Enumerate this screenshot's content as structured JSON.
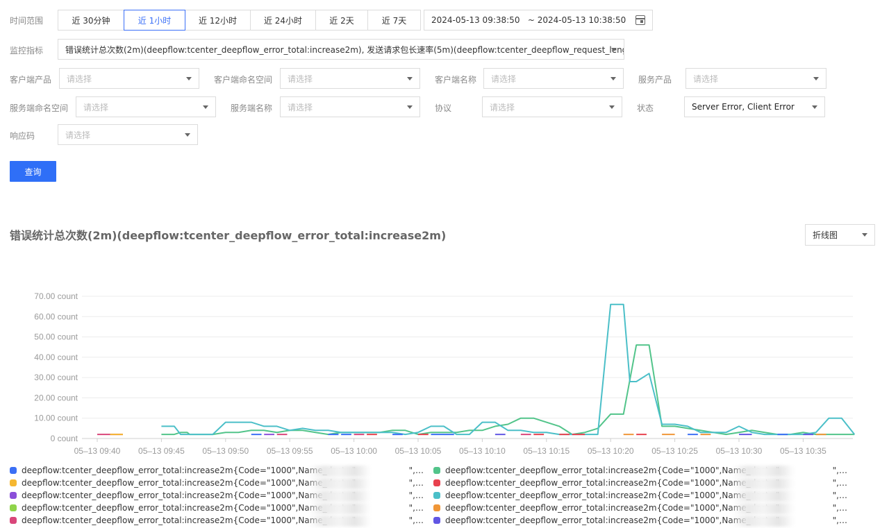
{
  "time_range": {
    "label": "时间范围",
    "options": [
      "近 30分钟",
      "近 1小时",
      "近 12小时",
      "近 24小时",
      "近 2天",
      "近 7天"
    ],
    "active_index": 1,
    "range_text": "2024-05-13 09:38:50   ~ 2024-05-13 10:38:50"
  },
  "metric": {
    "label": "监控指标",
    "value": "错误统计总次数(2m)(deepflow:tcenter_deepflow_error_total:increase2m), 发送请求包长速率(5m)(deepflow:tcenter_deepflow_request_length:ra..."
  },
  "filters": {
    "client_product": {
      "label": "客户端产品",
      "placeholder": "请选择"
    },
    "client_namespace": {
      "label": "客户端命名空间",
      "placeholder": "请选择"
    },
    "client_name": {
      "label": "客户端名称",
      "placeholder": "请选择"
    },
    "service_product": {
      "label": "服务产品",
      "placeholder": "请选择"
    },
    "server_namespace": {
      "label": "服务端命名空间",
      "placeholder": "请选择"
    },
    "server_name": {
      "label": "服务端名称",
      "placeholder": "请选择"
    },
    "protocol": {
      "label": "协议",
      "placeholder": "请选择"
    },
    "status": {
      "label": "状态",
      "value": "Server Error, Client Error"
    },
    "response_code": {
      "label": "响应码",
      "placeholder": "请选择"
    }
  },
  "query_button": "查询",
  "chart_panel": {
    "title": "错误统计总次数(2m)(deepflow:tcenter_deepflow_error_total:increase2m)",
    "chart_type": "折线图"
  },
  "chart_data": {
    "type": "line",
    "ylim": [
      0,
      70
    ],
    "y_ticks": [
      "0 count",
      "10.00 count",
      "20.00 count",
      "30.00 count",
      "40.00 count",
      "50.00 count",
      "60.00 count",
      "70.00 count"
    ],
    "x_ticks": [
      "05–13 09:40",
      "05–13 09:45",
      "05–13 09:50",
      "05–13 09:55",
      "05–13 10:00",
      "05–13 10:05",
      "05–13 10:10",
      "05–13 10:15",
      "05–13 10:20",
      "05–13 10:25",
      "05–13 10:30",
      "05–13 10:35"
    ],
    "x_minutes_from_0940": true,
    "series": [
      {
        "color": "#52c48a",
        "points": [
          [
            5,
            2
          ],
          [
            6,
            2
          ],
          [
            6.5,
            3
          ],
          [
            7,
            3
          ],
          [
            7.2,
            2
          ],
          [
            8,
            2
          ],
          [
            9,
            2
          ],
          [
            10,
            3
          ],
          [
            11,
            3
          ],
          [
            12,
            4
          ],
          [
            13,
            4
          ],
          [
            14,
            3
          ],
          [
            15,
            4
          ],
          [
            16,
            4
          ],
          [
            17,
            3
          ],
          [
            18,
            2
          ],
          [
            19,
            3
          ],
          [
            20,
            3
          ],
          [
            21,
            3
          ],
          [
            22,
            3
          ],
          [
            23,
            4
          ],
          [
            24,
            4
          ],
          [
            25,
            2
          ],
          [
            26,
            3
          ],
          [
            27,
            3
          ],
          [
            28,
            3
          ],
          [
            29,
            4
          ],
          [
            30,
            4
          ],
          [
            31,
            6
          ],
          [
            32,
            7
          ],
          [
            33,
            10
          ],
          [
            34,
            10
          ],
          [
            35,
            8
          ],
          [
            36,
            6
          ],
          [
            37,
            2
          ],
          [
            38,
            3
          ],
          [
            39,
            5
          ],
          [
            40,
            12
          ],
          [
            41,
            12
          ],
          [
            42,
            46
          ],
          [
            43,
            46
          ],
          [
            44,
            6
          ],
          [
            45,
            6
          ],
          [
            46,
            5
          ],
          [
            47,
            4
          ],
          [
            48,
            3
          ],
          [
            49,
            2
          ],
          [
            50,
            3
          ],
          [
            51,
            4
          ],
          [
            52,
            3
          ],
          [
            53,
            2
          ],
          [
            54,
            2
          ],
          [
            55,
            3
          ],
          [
            56,
            2
          ],
          [
            57,
            2
          ],
          [
            58,
            2
          ],
          [
            59,
            2
          ]
        ]
      },
      {
        "color": "#4bbfc8",
        "points": [
          [
            5,
            6
          ],
          [
            6,
            6
          ],
          [
            6.5,
            2
          ],
          [
            7,
            2
          ],
          [
            8,
            2
          ],
          [
            9,
            2
          ],
          [
            10,
            8
          ],
          [
            11,
            8
          ],
          [
            12,
            8
          ],
          [
            13,
            6
          ],
          [
            14,
            6
          ],
          [
            15,
            4
          ],
          [
            16,
            5
          ],
          [
            17,
            4
          ],
          [
            18,
            4
          ],
          [
            19,
            3
          ],
          [
            20,
            3
          ],
          [
            21,
            3
          ],
          [
            22,
            3
          ],
          [
            23,
            3
          ],
          [
            24,
            2
          ],
          [
            25,
            3
          ],
          [
            26,
            6
          ],
          [
            27,
            6
          ],
          [
            28,
            2
          ],
          [
            29,
            2
          ],
          [
            30,
            8
          ],
          [
            31,
            8
          ],
          [
            32,
            4
          ],
          [
            33,
            4
          ],
          [
            34,
            3
          ],
          [
            35,
            3
          ],
          [
            36,
            2
          ],
          [
            37,
            2
          ],
          [
            38,
            2
          ],
          [
            39,
            2
          ],
          [
            40,
            66
          ],
          [
            41,
            66
          ],
          [
            41.5,
            28
          ],
          [
            42,
            28
          ],
          [
            43,
            32
          ],
          [
            44,
            7
          ],
          [
            45,
            7
          ],
          [
            46,
            6
          ],
          [
            47,
            3
          ],
          [
            48,
            3
          ],
          [
            49,
            3
          ],
          [
            50,
            6
          ],
          [
            51,
            3
          ],
          [
            52,
            2
          ],
          [
            53,
            2
          ],
          [
            54,
            2
          ],
          [
            55,
            2
          ],
          [
            56,
            3
          ],
          [
            57,
            10
          ],
          [
            58,
            10
          ],
          [
            59,
            2
          ]
        ]
      },
      {
        "color": "#d9467a",
        "points": [
          [
            0,
            2
          ],
          [
            2,
            2
          ]
        ]
      },
      {
        "color": "#f5b731",
        "points": [
          [
            1,
            2
          ],
          [
            2,
            2
          ]
        ]
      },
      {
        "color": "#e8414e",
        "points": [
          [
            37,
            2
          ],
          [
            38,
            2
          ]
        ]
      },
      {
        "color": "#f09637",
        "points": [
          [
            44,
            2
          ],
          [
            45,
            2
          ]
        ]
      },
      {
        "color": "#3b6ff5",
        "points": [
          [
            26,
            2
          ],
          [
            27,
            2
          ]
        ]
      },
      {
        "color": "#6156e3",
        "points": [
          [
            50,
            2
          ],
          [
            51,
            2
          ]
        ]
      }
    ]
  },
  "legend": {
    "left": [
      {
        "color": "#3b6ff5",
        "text": "deepflow:tcenter_deepflow_error_total:increase2m{Code=\"1000\",Name_dest=\"                    \",Name_src=..."
      },
      {
        "color": "#f5b731",
        "text": "deepflow:tcenter_deepflow_error_total:increase2m{Code=\"1000\",Name_dest=\"                    \",Name_src=..."
      },
      {
        "color": "#8b4fd9",
        "text": "deepflow:tcenter_deepflow_error_total:increase2m{Code=\"1000\",Name_dest=\"                    \",Name_src=..."
      },
      {
        "color": "#8fd44a",
        "text": "deepflow:tcenter_deepflow_error_total:increase2m{Code=\"1000\",Name_dest=\"                    \",Name_src=..."
      },
      {
        "color": "#d9467a",
        "text": "deepflow:tcenter_deepflow_error_total:increase2m{Code=\"1000\",Name_dest=\"                    \",Name_src=..."
      }
    ],
    "right": [
      {
        "color": "#52c48a",
        "text": "deepflow:tcenter_deepflow_error_total:increase2m{Code=\"1000\",Name_dest=\"                    \",Name_src=..."
      },
      {
        "color": "#e8414e",
        "text": "deepflow:tcenter_deepflow_error_total:increase2m{Code=\"1000\",Name_dest=\"                    \",Name_src=..."
      },
      {
        "color": "#4bbfc8",
        "text": "deepflow:tcenter_deepflow_error_total:increase2m{Code=\"1000\",Name_dest=\"                    \",Name_src=..."
      },
      {
        "color": "#f09637",
        "text": "deepflow:tcenter_deepflow_error_total:increase2m{Code=\"1000\",Name_dest=\"                    \",Name_src=..."
      },
      {
        "color": "#6156e3",
        "text": "deepflow:tcenter_deepflow_error_total:increase2m{Code=\"1000\",Name_dest=\"                    \",Name_src=..."
      }
    ]
  }
}
